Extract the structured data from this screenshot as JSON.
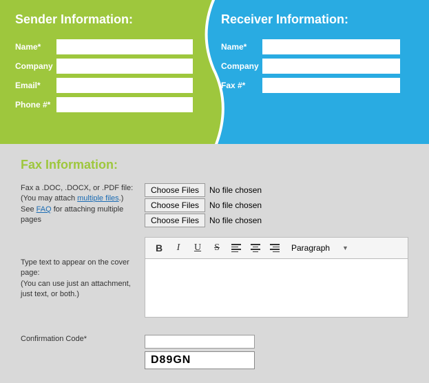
{
  "sender": {
    "title": "Sender Information:",
    "name_label": "Name*",
    "company_label": "Company",
    "email_label": "Email*",
    "phone_label": "Phone #*"
  },
  "receiver": {
    "title": "Receiver Information:",
    "name_label": "Name*",
    "company_label": "Company",
    "fax_label": "Fax #*"
  },
  "fax": {
    "title": "Fax Information:",
    "file_text_1": "Fax a .DOC, .DOCX, or .PDF file:",
    "file_text_2a": "(You may attach ",
    "file_text_2b": "multiple files",
    "file_text_2c": ".)",
    "file_text_3a": "See ",
    "file_text_3b": "FAQ",
    "file_text_3c": " for attaching multiple pages",
    "choose_label": "Choose Files",
    "no_file": "No file chosen",
    "cover_text_1": "Type text to appear on the cover page:",
    "cover_text_2": "(You can use just an attachment, just text, or both.)",
    "toolbar": {
      "bold": "B",
      "italic": "I",
      "underline": "U",
      "strike": "S",
      "paragraph": "Paragraph"
    },
    "confirm_label": "Confirmation Code*",
    "captcha": "D89GN"
  }
}
